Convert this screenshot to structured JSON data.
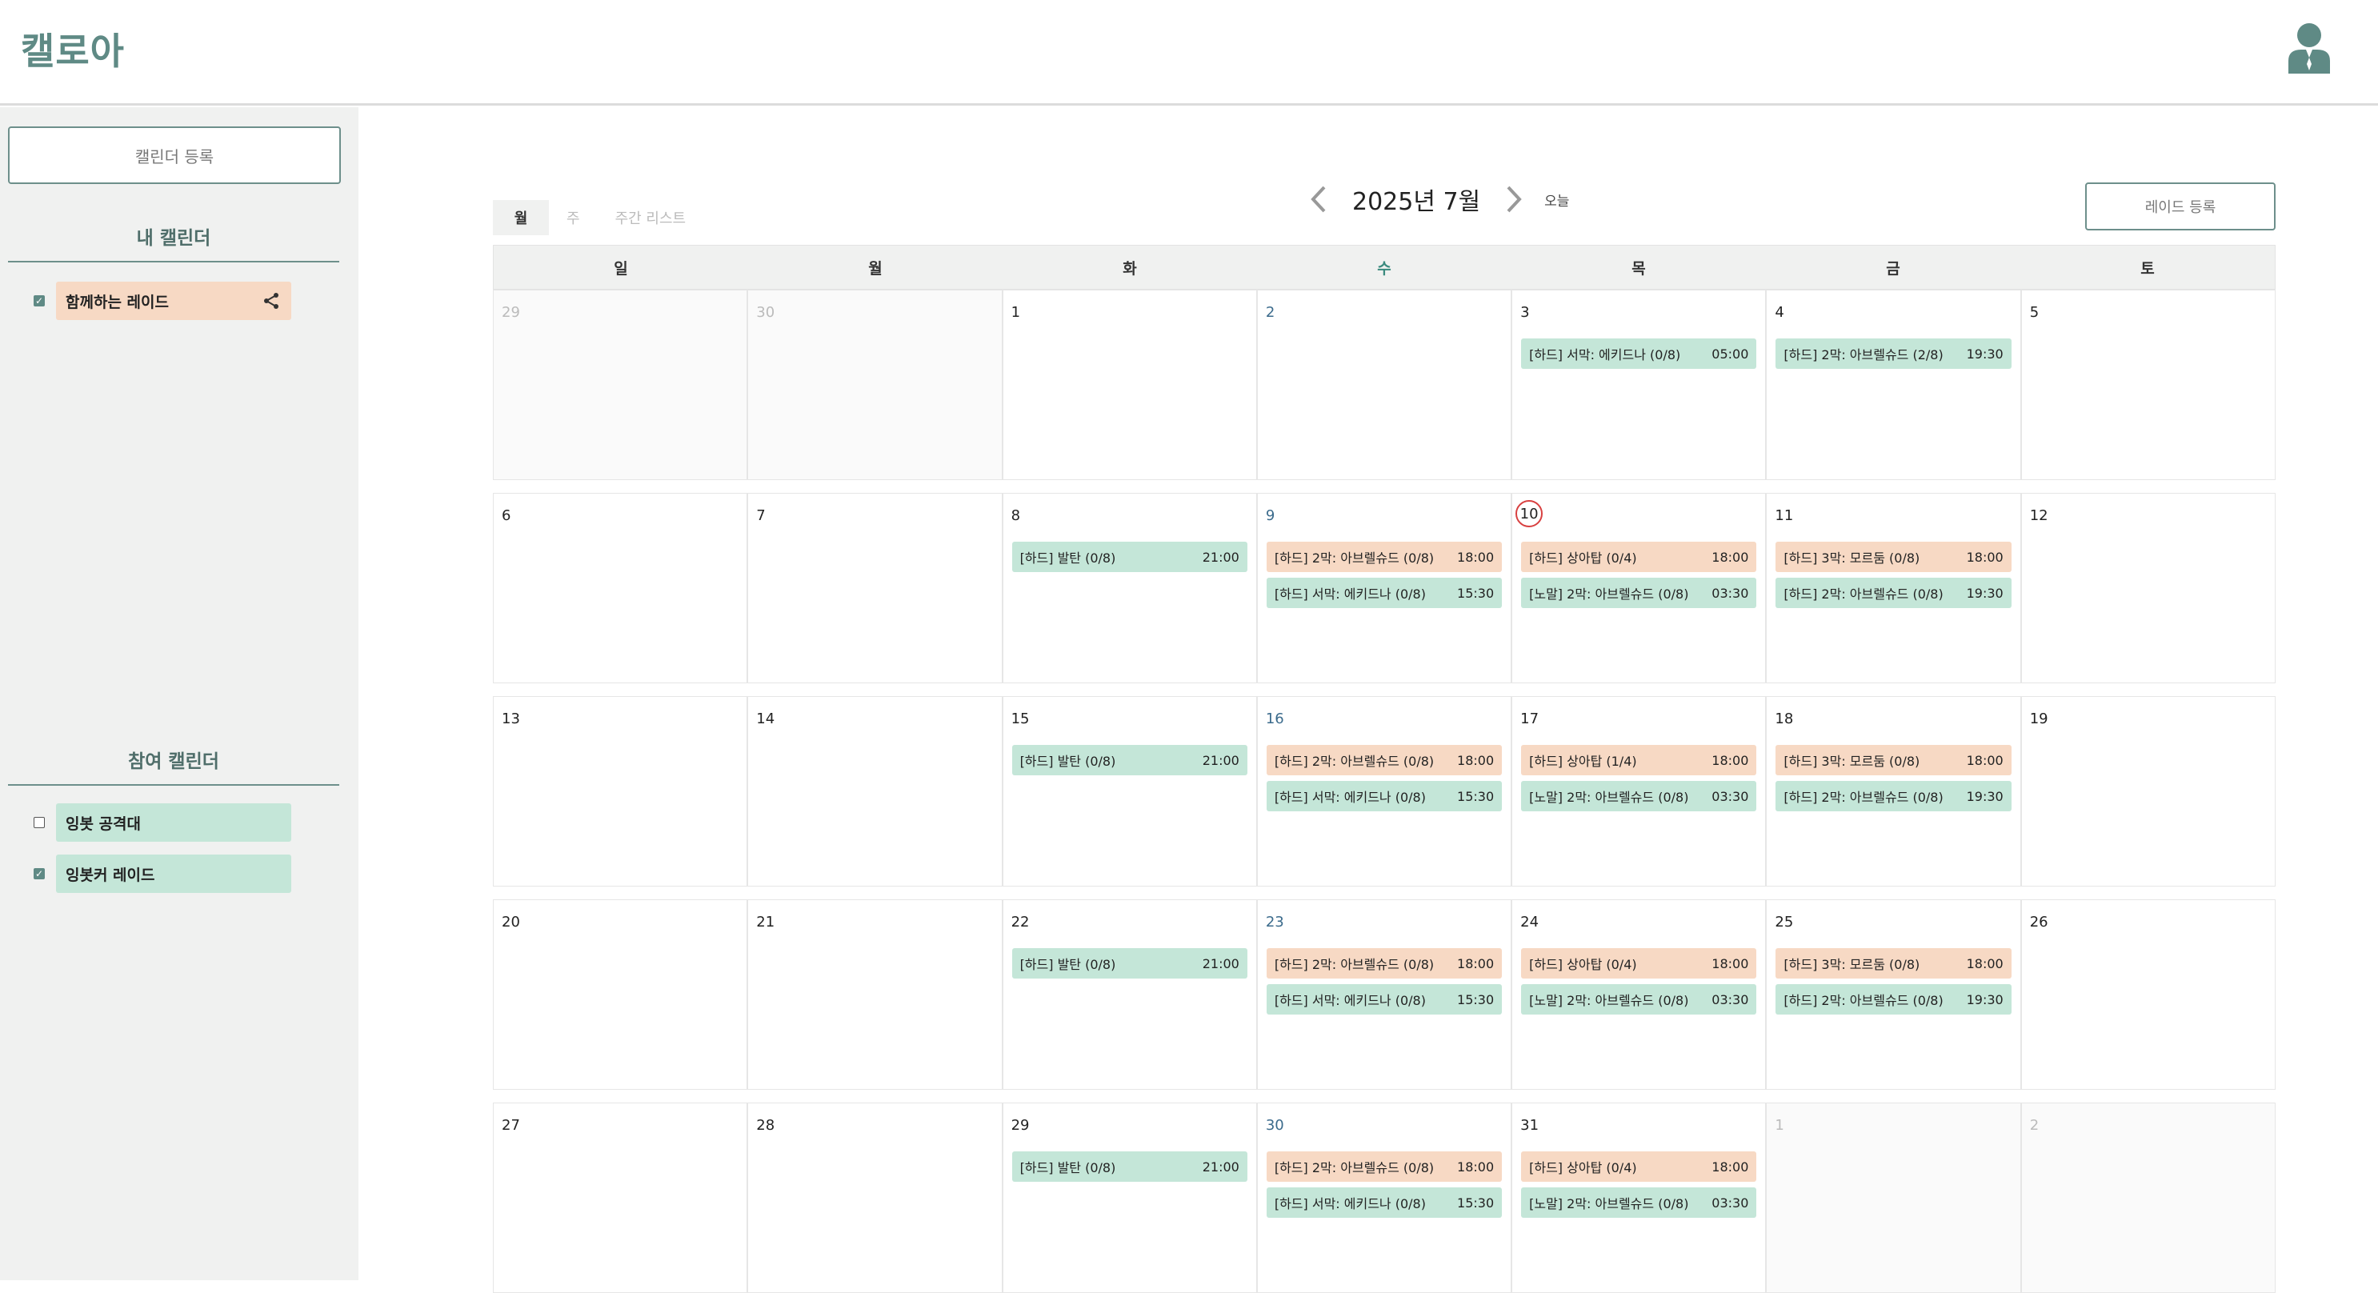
{
  "app": {
    "title": "캘로아"
  },
  "sidebar": {
    "add_calendar_label": "캘린더 등록",
    "my_calendars_title": "내 캘린더",
    "my_calendars": [
      {
        "label": "함께하는 레이드",
        "checked": true,
        "color": "#f7d9c4",
        "shareable": true
      }
    ],
    "joined_calendars_title": "참여 캘린더",
    "joined_calendars": [
      {
        "label": "잉봇 공격대",
        "checked": false,
        "color": "#c4e6d8"
      },
      {
        "label": "잉봇커 레이드",
        "checked": true,
        "color": "#c4e6d8"
      }
    ]
  },
  "toolbar": {
    "view_tabs": [
      "월",
      "주",
      "주간 리스트"
    ],
    "active_view": "월",
    "month_title": "2025년 7월",
    "today_label": "오늘",
    "add_raid_label": "레이드 등록"
  },
  "calendar": {
    "weekdays": [
      "일",
      "월",
      "화",
      "수",
      "목",
      "금",
      "토"
    ],
    "highlight_weekday": "수",
    "today": "10",
    "weeks": [
      [
        {
          "d": "29",
          "other": true,
          "events": []
        },
        {
          "d": "30",
          "other": true,
          "events": []
        },
        {
          "d": "1",
          "events": []
        },
        {
          "d": "2",
          "events": []
        },
        {
          "d": "3",
          "events": [
            {
              "title": "[하드] 서막: 에키드나 (0/8)",
              "time": "05:00",
              "color": "green"
            }
          ]
        },
        {
          "d": "4",
          "events": [
            {
              "title": "[하드] 2막: 아브렐슈드 (2/8)",
              "time": "19:30",
              "color": "green"
            }
          ]
        },
        {
          "d": "5",
          "events": []
        }
      ],
      [
        {
          "d": "6",
          "events": []
        },
        {
          "d": "7",
          "events": []
        },
        {
          "d": "8",
          "events": [
            {
              "title": "[하드] 발탄 (0/8)",
              "time": "21:00",
              "color": "green"
            }
          ]
        },
        {
          "d": "9",
          "events": [
            {
              "title": "[하드] 2막: 아브렐슈드 (0/8)",
              "time": "18:00",
              "color": "orange"
            },
            {
              "title": "[하드] 서막: 에키드나 (0/8)",
              "time": "15:30",
              "color": "green"
            }
          ]
        },
        {
          "d": "10",
          "events": [
            {
              "title": "[하드] 상아탑 (0/4)",
              "time": "18:00",
              "color": "orange"
            },
            {
              "title": "[노말] 2막: 아브렐슈드 (0/8)",
              "time": "03:30",
              "color": "green"
            }
          ]
        },
        {
          "d": "11",
          "events": [
            {
              "title": "[하드] 3막: 모르둠 (0/8)",
              "time": "18:00",
              "color": "orange"
            },
            {
              "title": "[하드] 2막: 아브렐슈드 (0/8)",
              "time": "19:30",
              "color": "green"
            }
          ]
        },
        {
          "d": "12",
          "events": []
        }
      ],
      [
        {
          "d": "13",
          "events": []
        },
        {
          "d": "14",
          "events": []
        },
        {
          "d": "15",
          "events": [
            {
              "title": "[하드] 발탄 (0/8)",
              "time": "21:00",
              "color": "green"
            }
          ]
        },
        {
          "d": "16",
          "events": [
            {
              "title": "[하드] 2막: 아브렐슈드 (0/8)",
              "time": "18:00",
              "color": "orange"
            },
            {
              "title": "[하드] 서막: 에키드나 (0/8)",
              "time": "15:30",
              "color": "green"
            }
          ]
        },
        {
          "d": "17",
          "events": [
            {
              "title": "[하드] 상아탑 (1/4)",
              "time": "18:00",
              "color": "orange"
            },
            {
              "title": "[노말] 2막: 아브렐슈드 (0/8)",
              "time": "03:30",
              "color": "green"
            }
          ]
        },
        {
          "d": "18",
          "events": [
            {
              "title": "[하드] 3막: 모르둠 (0/8)",
              "time": "18:00",
              "color": "orange"
            },
            {
              "title": "[하드] 2막: 아브렐슈드 (0/8)",
              "time": "19:30",
              "color": "green"
            }
          ]
        },
        {
          "d": "19",
          "events": []
        }
      ],
      [
        {
          "d": "20",
          "events": []
        },
        {
          "d": "21",
          "events": []
        },
        {
          "d": "22",
          "events": [
            {
              "title": "[하드] 발탄 (0/8)",
              "time": "21:00",
              "color": "green"
            }
          ]
        },
        {
          "d": "23",
          "events": [
            {
              "title": "[하드] 2막: 아브렐슈드 (0/8)",
              "time": "18:00",
              "color": "orange"
            },
            {
              "title": "[하드] 서막: 에키드나 (0/8)",
              "time": "15:30",
              "color": "green"
            }
          ]
        },
        {
          "d": "24",
          "events": [
            {
              "title": "[하드] 상아탑 (0/4)",
              "time": "18:00",
              "color": "orange"
            },
            {
              "title": "[노말] 2막: 아브렐슈드 (0/8)",
              "time": "03:30",
              "color": "green"
            }
          ]
        },
        {
          "d": "25",
          "events": [
            {
              "title": "[하드] 3막: 모르둠 (0/8)",
              "time": "18:00",
              "color": "orange"
            },
            {
              "title": "[하드] 2막: 아브렐슈드 (0/8)",
              "time": "19:30",
              "color": "green"
            }
          ]
        },
        {
          "d": "26",
          "events": []
        }
      ],
      [
        {
          "d": "27",
          "events": []
        },
        {
          "d": "28",
          "events": []
        },
        {
          "d": "29",
          "events": [
            {
              "title": "[하드] 발탄 (0/8)",
              "time": "21:00",
              "color": "green"
            }
          ]
        },
        {
          "d": "30",
          "events": [
            {
              "title": "[하드] 2막: 아브렐슈드 (0/8)",
              "time": "18:00",
              "color": "orange"
            },
            {
              "title": "[하드] 서막: 에키드나 (0/8)",
              "time": "15:30",
              "color": "green"
            }
          ]
        },
        {
          "d": "31",
          "events": [
            {
              "title": "[하드] 상아탑 (0/4)",
              "time": "18:00",
              "color": "orange"
            },
            {
              "title": "[노말] 2막: 아브렐슈드 (0/8)",
              "time": "03:30",
              "color": "green"
            }
          ]
        },
        {
          "d": "1",
          "other": true,
          "events": []
        },
        {
          "d": "2",
          "other": true,
          "events": []
        }
      ]
    ]
  },
  "colors": {
    "orange": "#f7d9c4",
    "green": "#c4e6d8",
    "accent": "#5f8a85",
    "today_ring": "#d84040"
  },
  "icons": {
    "prev": "chevron-left-icon",
    "next": "chevron-right-icon",
    "share": "share-icon",
    "profile": "user-icon"
  }
}
